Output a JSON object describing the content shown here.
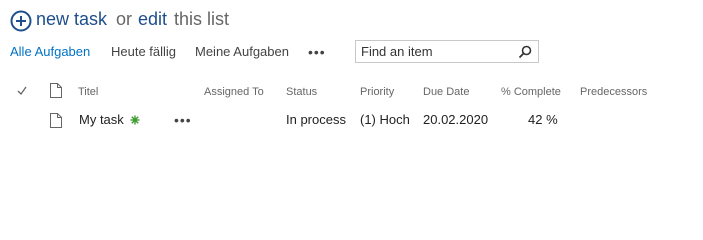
{
  "header": {
    "new_label": "new task",
    "or_label": "or",
    "edit_label": "edit",
    "this_list_label": "this list"
  },
  "views": [
    {
      "label": "Alle Aufgaben",
      "active": true
    },
    {
      "label": "Heute fällig",
      "active": false
    },
    {
      "label": "Meine Aufgaben",
      "active": false
    }
  ],
  "more_label": "•••",
  "search": {
    "placeholder": "Find an item"
  },
  "columns": {
    "title": "Titel",
    "assigned_to": "Assigned To",
    "status": "Status",
    "priority": "Priority",
    "due_date": "Due Date",
    "percent_complete": "% Complete",
    "predecessors": "Predecessors"
  },
  "rows": [
    {
      "title": "My task",
      "assigned_to": "",
      "status": "In process",
      "priority": "(1) Hoch",
      "due_date": "20.02.2020",
      "percent_complete": "42 %",
      "predecessors": ""
    }
  ],
  "colors": {
    "link": "#1e4e8c",
    "active_view": "#0072c6",
    "new_badge": "#3a9b2e"
  },
  "icons": [
    "plus-circle-icon",
    "search-icon",
    "check-icon",
    "document-icon",
    "new-item-icon"
  ]
}
